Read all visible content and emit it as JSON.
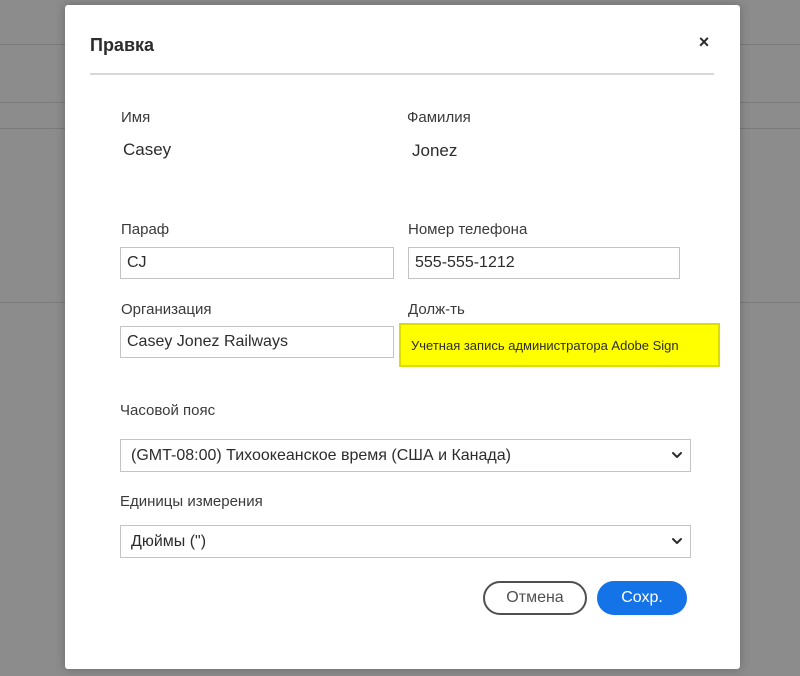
{
  "dialog": {
    "title": "Правка",
    "close_symbol": "×"
  },
  "form": {
    "first_name": {
      "label": "Имя",
      "value": "Casey"
    },
    "last_name": {
      "label": "Фамилия",
      "value": "Jonez"
    },
    "initials": {
      "label": "Параф",
      "value": "CJ"
    },
    "phone": {
      "label": "Номер телефона",
      "value": "555-555-1212"
    },
    "company": {
      "label": "Организация",
      "value": "Casey Jonez Railways"
    },
    "title": {
      "label": "Долж-ть",
      "value": "Учетная запись администратора Adobe Sign"
    },
    "timezone": {
      "label": "Часовой пояс",
      "value": "(GMT-08:00) Тихоокеанское время (США и Канада)"
    },
    "units": {
      "label": "Единицы измерения",
      "value": "Дюймы (\")"
    }
  },
  "buttons": {
    "cancel": "Отмена",
    "save": "Сохр."
  },
  "colors": {
    "accent": "#1473e6",
    "highlight": "#ffff00",
    "overlay": "#8c8c8c"
  }
}
